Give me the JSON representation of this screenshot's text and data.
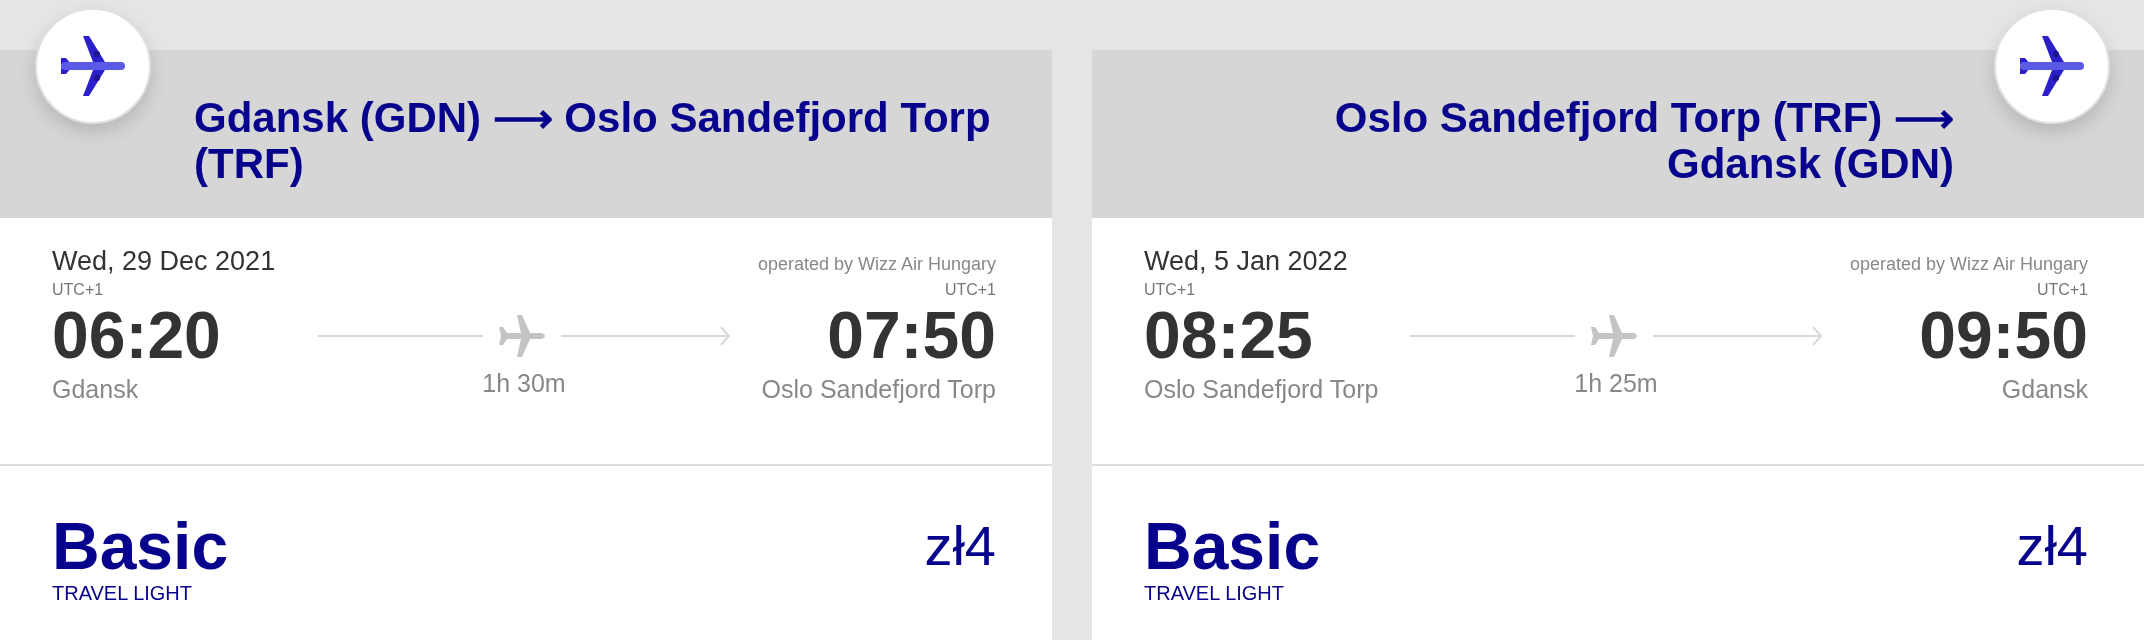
{
  "flights": [
    {
      "kind": "outbound",
      "title": "Gdansk (GDN) ⟶ Oslo Sandefjord Torp (TRF)",
      "date": "Wed, 29 Dec 2021",
      "operator": "operated by Wizz Air Hungary",
      "departure": {
        "timezone": "UTC+1",
        "time": "06:20",
        "city": "Gdansk"
      },
      "duration": "1h 30m",
      "arrival": {
        "timezone": "UTC+1",
        "time": "07:50",
        "city": "Oslo Sandefjord Torp"
      },
      "fare": {
        "name": "Basic",
        "subtitle": "TRAVEL LIGHT",
        "price": "zł4"
      }
    },
    {
      "kind": "return",
      "title": "Oslo Sandefjord Torp (TRF) ⟶ Gdansk (GDN)",
      "date": "Wed, 5 Jan 2022",
      "operator": "operated by Wizz Air Hungary",
      "departure": {
        "timezone": "UTC+1",
        "time": "08:25",
        "city": "Oslo Sandefjord Torp"
      },
      "duration": "1h 25m",
      "arrival": {
        "timezone": "UTC+1",
        "time": "09:50",
        "city": "Gdansk"
      },
      "fare": {
        "name": "Basic",
        "subtitle": "TRAVEL LIGHT",
        "price": "zł4"
      }
    }
  ]
}
